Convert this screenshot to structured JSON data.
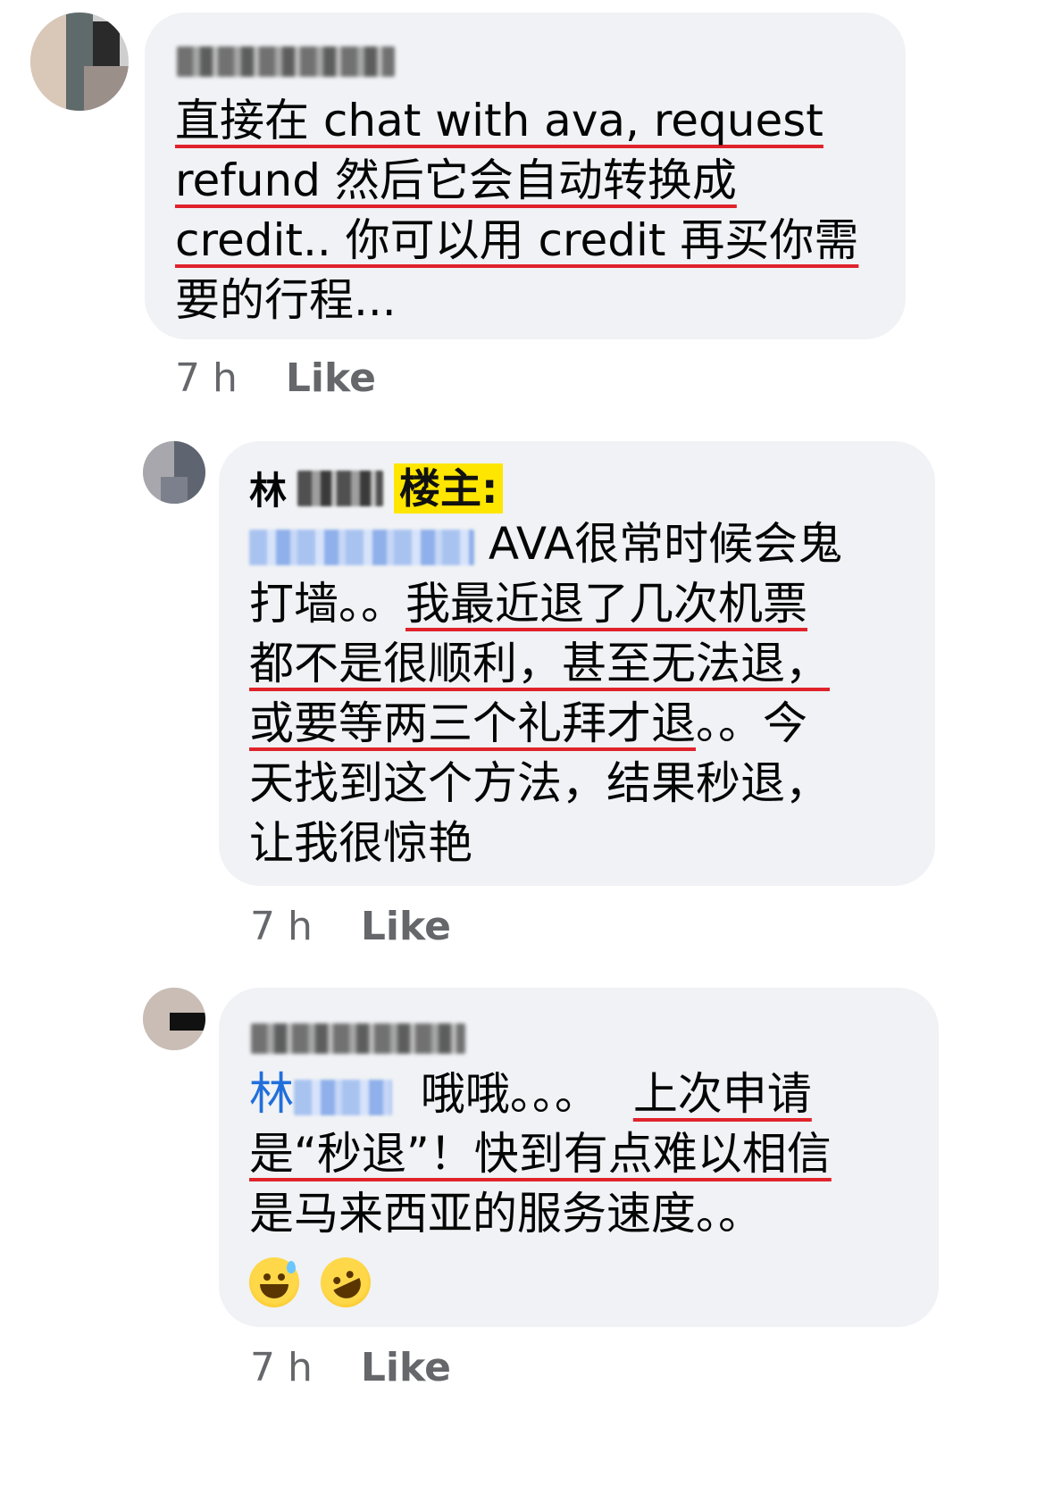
{
  "comments": [
    {
      "author_label": "Rachel Yin",
      "lines": [
        "直接在 chat with ava, request",
        "refund 然后它会自动转换成",
        "credit.. 你可以用 credit 再买你需",
        "要的行程..."
      ],
      "time": "7 h",
      "like": "Like"
    },
    {
      "author_initial": "林",
      "author_tag": "楼主:",
      "lines_suffix": [
        "AVA很常时候会鬼",
        "打墙。。",
        "我最近退了几次机票",
        "都不是很顺利，甚至无法退，",
        "或要等两三个礼拜才退",
        "。。今",
        "天找到这个方法，结果秒退，",
        "让我很惊艳"
      ],
      "time": "7 h",
      "like": "Like"
    },
    {
      "mention_initial": "林",
      "lines": [
        "哦哦。。。",
        "上次申请",
        "是“秒退”！快到有点难以相信",
        "是马来西亚的服务速度。。"
      ],
      "time": "7 h",
      "like": "Like",
      "emojis": [
        "sweat-smile-emoji",
        "rofl-emoji"
      ]
    }
  ]
}
